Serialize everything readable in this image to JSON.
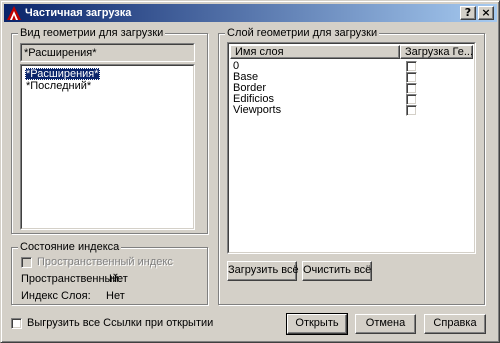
{
  "window": {
    "title": "Частичная загрузка",
    "help_glyph": "?",
    "close_glyph": "×"
  },
  "view_group": {
    "label": "Вид геометрии для загрузки",
    "current_value": "*Расширения*",
    "items": [
      {
        "label": "*Расширения*",
        "selected": true
      },
      {
        "label": "*Последний*",
        "selected": false
      }
    ]
  },
  "index_group": {
    "label": "Состояние индекса",
    "spatial_index_checkbox_label": "Пространственный индекс",
    "spatial_row_label": "Пространственный:",
    "spatial_row_value": "Нет",
    "layer_row_label": "Индекс Слоя:",
    "layer_row_value": "Нет"
  },
  "layer_group": {
    "label": "Слой геометрии для загрузки",
    "columns": [
      "Имя слоя",
      "Загрузка Ге..."
    ],
    "layers": [
      {
        "name": "0",
        "checked": false
      },
      {
        "name": "Base",
        "checked": false
      },
      {
        "name": "Border",
        "checked": false
      },
      {
        "name": "Edificios",
        "checked": false
      },
      {
        "name": "Viewports",
        "checked": false
      }
    ],
    "load_all_button": "Загрузить всё",
    "clear_all_button": "Очистить всё"
  },
  "footer": {
    "unload_xrefs_label": "Выгрузить все Ссылки при открытии",
    "open_button": "Открыть",
    "cancel_button": "Отмена",
    "help_button": "Справка"
  },
  "colors": {
    "face": "#d4d0c8",
    "title_start": "#0a246a",
    "title_end": "#a6caf0",
    "selection": "#0a246a"
  }
}
